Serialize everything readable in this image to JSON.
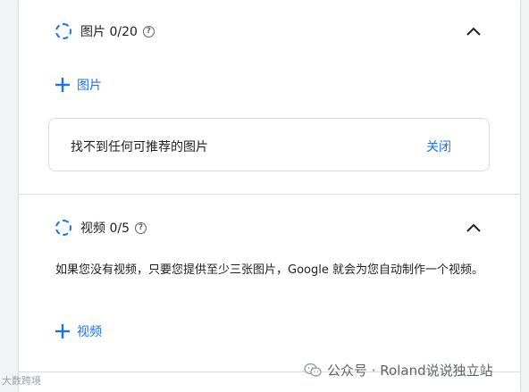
{
  "images_section": {
    "title": "图片 0/20",
    "help_glyph": "?",
    "add_label": "图片",
    "notice": {
      "text": "找不到任何可推荐的图片",
      "close_label": "关闭"
    }
  },
  "videos_section": {
    "title": "视频 0/5",
    "help_glyph": "?",
    "description": "如果您没有视频，只要您提供至少三张图片，Google 就会为您自动制作一个视频。",
    "add_label": "视频"
  },
  "watermarks": {
    "left": "大数跨境",
    "right": "公众号 · Roland说说独立站"
  },
  "icons": {
    "status": "dashed-circle-icon",
    "help": "question-circle-icon",
    "collapse": "chevron-up-icon",
    "add": "plus-icon",
    "wechat": "wechat-icon"
  },
  "colors": {
    "accent": "#1a73e8",
    "text": "#202124",
    "muted": "#5f6368",
    "border": "#dadce0",
    "background": "#f1f3f4"
  }
}
